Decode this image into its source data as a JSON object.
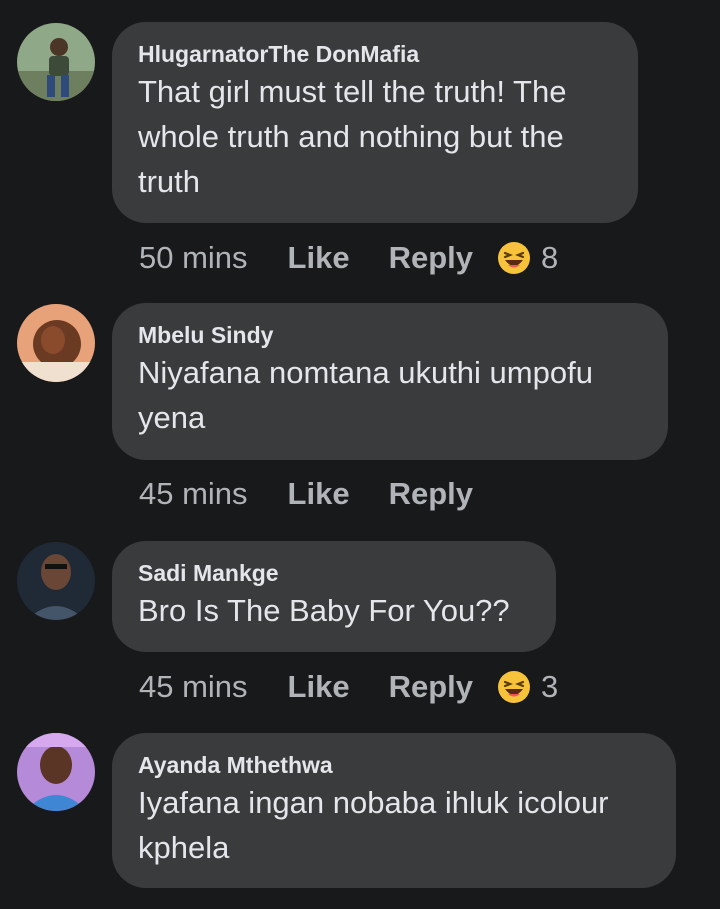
{
  "comments": [
    {
      "author": "HlugarnatorThe DonMafia",
      "text": "That girl must tell the truth! The whole truth and nothing but the truth",
      "time": "50 mins",
      "like": "Like",
      "reply": "Reply",
      "reaction_icon": "laughing-emoji-icon",
      "reaction_count": "8",
      "avatar_colors": [
        "#6b8f6a",
        "#2f3b4a"
      ]
    },
    {
      "author": "Mbelu Sindy",
      "text": "Niyafana nomtana ukuthi umpofu yena",
      "time": "45 mins",
      "like": "Like",
      "reply": "Reply",
      "avatar_colors": [
        "#c97a4e",
        "#4a2a1e"
      ]
    },
    {
      "author": "Sadi Mankge",
      "text": "Bro Is The Baby For You??",
      "time": "45 mins",
      "like": "Like",
      "reply": "Reply",
      "reaction_icon": "laughing-emoji-icon",
      "reaction_count": "3",
      "avatar_colors": [
        "#7a5a4a",
        "#22303c"
      ]
    },
    {
      "author": "Ayanda Mthethwa",
      "text": "Iyafana ingan nobaba ihluk icolour kphela",
      "time": "",
      "like": "",
      "reply": "",
      "avatar_colors": [
        "#a06ad0",
        "#3a7ac0"
      ]
    }
  ],
  "colors": {
    "background": "#18191a",
    "bubble": "#3a3b3c",
    "text": "#e4e6eb",
    "secondary": "#b0b3b8",
    "emoji": "#f7c33b"
  }
}
